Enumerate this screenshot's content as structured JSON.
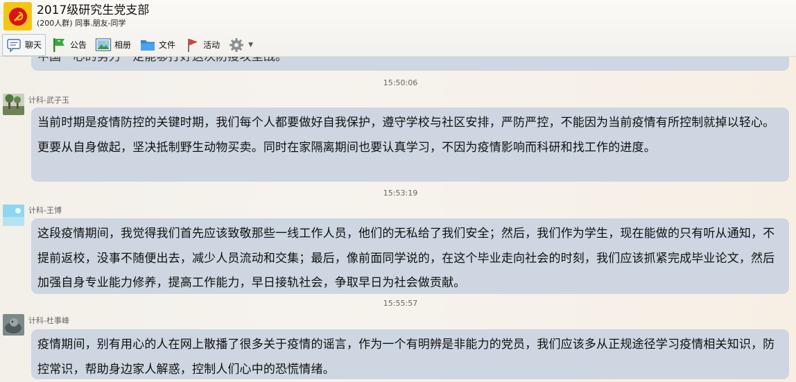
{
  "group": {
    "title": "2017级研究生党支部",
    "subtitle": "(200人群) 同事.朋友-同学"
  },
  "toolbar": {
    "chat_label": "聊天",
    "notice_label": "公告",
    "album_label": "相册",
    "file_label": "文件",
    "activity_label": "活动"
  },
  "messages": [
    {
      "text": "中国一心的努力一定能够打好这次防疫攻坚战。"
    },
    {
      "time": "15:50:06",
      "sender": "计科-武子玉",
      "text": "当前时期是疫情防控的关键时期，我们每个人都要做好自我保护，遵守学校与社区安排，严防严控，不能因为当前疫情有所控制就掉以轻心。更要从自身做起，坚决抵制野生动物买卖。同时在家隔离期间也要认真学习，不因为疫情影响而科研和找工作的进度。"
    },
    {
      "time": "15:53:19",
      "sender": "计科-王博",
      "text": "这段疫情期间，我觉得我们首先应该致敬那些一线工作人员，他们的无私给了我们安全；然后，我们作为学生，现在能做的只有听从通知，不提前返校，没事不随便出去，减少人员流动和交集；最后，像前面同学说的，在这个毕业走向社会的时刻，我们应该抓紧完成毕业论文，然后加强自身专业能力修养，提高工作能力，早日接轨社会，争取早日为社会做贡献。"
    },
    {
      "time": "15:55:57",
      "sender": "计科-杜事峰",
      "text": "疫情期间，别有用心的人在网上散播了很多关于疫情的谣言，作为一个有明辨是非能力的党员，我们应该多从正规途径学习疫情相关知识，防控常识，帮助身边家人解惑，控制人们心中的恐慌情绪。"
    }
  ],
  "colors": {
    "bubble": "#cdd6e1",
    "accent_red": "#d8141a",
    "accent_yellow": "#f6c514"
  }
}
